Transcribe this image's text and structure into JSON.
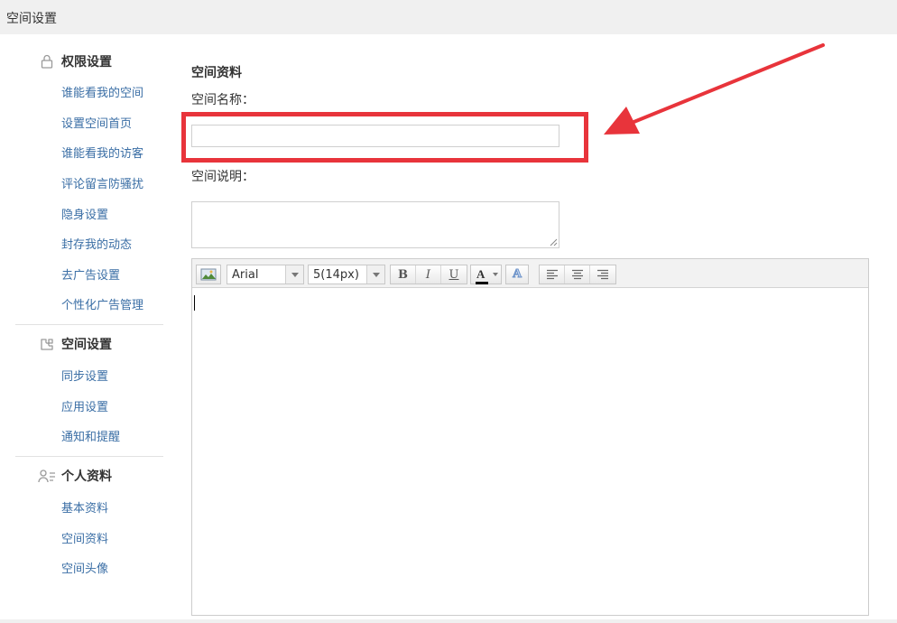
{
  "topbar": {
    "title": "空间设置"
  },
  "sidebar": {
    "sections": [
      {
        "title": "权限设置",
        "icon": "lock-icon",
        "items": [
          "谁能看我的空间",
          "设置空间首页",
          "谁能看我的访客",
          "评论留言防骚扰",
          "隐身设置",
          "封存我的动态",
          "去广告设置",
          "个性化广告管理"
        ]
      },
      {
        "title": "空间设置",
        "icon": "puzzle-icon",
        "items": [
          "同步设置",
          "应用设置",
          "通知和提醒"
        ]
      },
      {
        "title": "个人资料",
        "icon": "profile-icon",
        "items": [
          "基本资料",
          "空间资料",
          "空间头像"
        ]
      }
    ]
  },
  "main": {
    "section_title": "空间资料",
    "name_label": "空间名称：",
    "name_value": "",
    "desc_label": "空间说明：",
    "desc_value": ""
  },
  "editor": {
    "font_family": "Arial",
    "font_size": "5(14px)",
    "bold": "B",
    "italic": "I",
    "underline": "U",
    "font_color": "A",
    "highlight": "A"
  },
  "colors": {
    "link": "#3a6ea5",
    "highlight_red": "#e8343b"
  }
}
